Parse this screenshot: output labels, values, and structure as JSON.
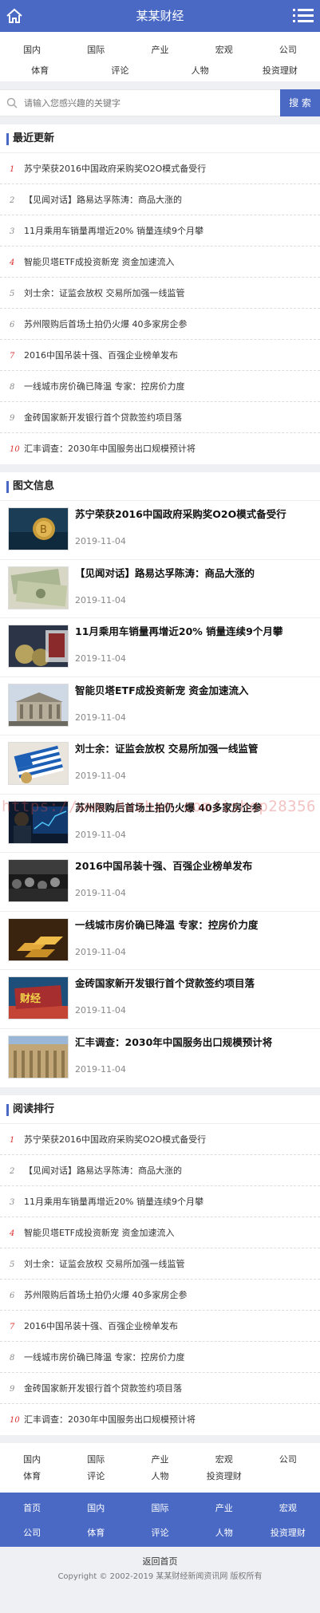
{
  "header": {
    "title": "某某财经"
  },
  "nav": {
    "row1": [
      "国内",
      "国际",
      "产业",
      "宏观",
      "公司"
    ],
    "row2": [
      "体育",
      "评论",
      "人物",
      "投资理财"
    ]
  },
  "search": {
    "placeholder": "请输入您感兴趣的关键字",
    "button": "搜 索"
  },
  "latest": {
    "title": "最近更新",
    "items": [
      {
        "num": "1",
        "text": "苏宁荣获2016中国政府采购奖O2O模式备受行"
      },
      {
        "num": "2",
        "text": "【见闻对话】路易达孚陈涛：商品大涨的"
      },
      {
        "num": "3",
        "text": "11月乘用车销量再增近20% 销量连续9个月攀"
      },
      {
        "num": "4",
        "text": "智能贝塔ETF成投资新宠 资金加速流入"
      },
      {
        "num": "5",
        "text": "刘士余：证监会放权 交易所加强一线监管"
      },
      {
        "num": "6",
        "text": "苏州限购后首场土拍仍火爆 40多家房企参"
      },
      {
        "num": "7",
        "text": "2016中国吊装十强、百强企业榜单发布"
      },
      {
        "num": "8",
        "text": "一线城市房价确已降温 专家：控房价力度"
      },
      {
        "num": "9",
        "text": "金砖国家新开发银行首个贷款签约项目落"
      },
      {
        "num": "10",
        "text": "汇丰调查：2030年中国服务出口规模预计将"
      }
    ]
  },
  "pictures": {
    "title": "图文信息",
    "items": [
      {
        "title": "苏宁荣获2016中国政府采购奖O2O模式备受行",
        "date": "2019-11-04",
        "thumb": "bitcoin-photo"
      },
      {
        "title": "【见闻对话】路易达孚陈涛：商品大涨的",
        "date": "2019-11-04",
        "thumb": "banknotes-photo"
      },
      {
        "title": "11月乘用车销量再增近20% 销量连续9个月攀",
        "date": "2019-11-04",
        "thumb": "euro-coins-photo"
      },
      {
        "title": "智能贝塔ETF成投资新宠 资金加速流入",
        "date": "2019-11-04",
        "thumb": "bank-building-photo"
      },
      {
        "title": "刘士余：证监会放权 交易所加强一线监管",
        "date": "2019-11-04",
        "thumb": "greek-flag-photo"
      },
      {
        "title": "苏州限购后首场土拍仍火爆 40多家房企参",
        "date": "2019-11-04",
        "thumb": "trader-screen-photo"
      },
      {
        "title": "2016中国吊装十强、百强企业榜单发布",
        "date": "2019-11-04",
        "thumb": "stock-crowd-photo"
      },
      {
        "title": "一线城市房价确已降温 专家：控房价力度",
        "date": "2019-11-04",
        "thumb": "gold-bars-photo"
      },
      {
        "title": "金砖国家新开发银行首个贷款签约项目落",
        "date": "2019-11-04",
        "thumb": "finance-sign-photo"
      },
      {
        "title": "汇丰调查：2030年中国服务出口规模预计将",
        "date": "2019-11-04",
        "thumb": "column-building-photo"
      }
    ]
  },
  "ranking": {
    "title": "阅读排行",
    "items": [
      {
        "num": "1",
        "text": "苏宁荣获2016中国政府采购奖O2O模式备受行"
      },
      {
        "num": "2",
        "text": "【见闻对话】路易达孚陈涛：商品大涨的"
      },
      {
        "num": "3",
        "text": "11月乘用车销量再增近20% 销量连续9个月攀"
      },
      {
        "num": "4",
        "text": "智能贝塔ETF成投资新宠 资金加速流入"
      },
      {
        "num": "5",
        "text": "刘士余：证监会放权 交易所加强一线监管"
      },
      {
        "num": "6",
        "text": "苏州限购后首场土拍仍火爆 40多家房企参"
      },
      {
        "num": "7",
        "text": "2016中国吊装十强、百强企业榜单发布"
      },
      {
        "num": "8",
        "text": "一线城市房价确已降温 专家：控房价力度"
      },
      {
        "num": "9",
        "text": "金砖国家新开发银行首个贷款签约项目落"
      },
      {
        "num": "10",
        "text": "汇丰调查：2030年中国服务出口规模预计将"
      }
    ]
  },
  "footer_nav": {
    "row1": [
      "国内",
      "国际",
      "产业",
      "宏观",
      "公司"
    ],
    "row2": [
      "体育",
      "评论",
      "人物",
      "投资理财",
      ""
    ]
  },
  "bottom_nav": {
    "row1": [
      "首页",
      "国内",
      "国际",
      "产业",
      "宏观"
    ],
    "row2": [
      "公司",
      "体育",
      "评论",
      "人物",
      "投资理财"
    ]
  },
  "footer": {
    "back": "返回首页",
    "copyright": "Copyright © 2002-2019 某某财经新闻资讯网 版权所有"
  },
  "watermark": "https://www.huzhan.com/ishop28356",
  "colors": {
    "brand": "#4a69c4",
    "rank_red": "#d33333"
  }
}
